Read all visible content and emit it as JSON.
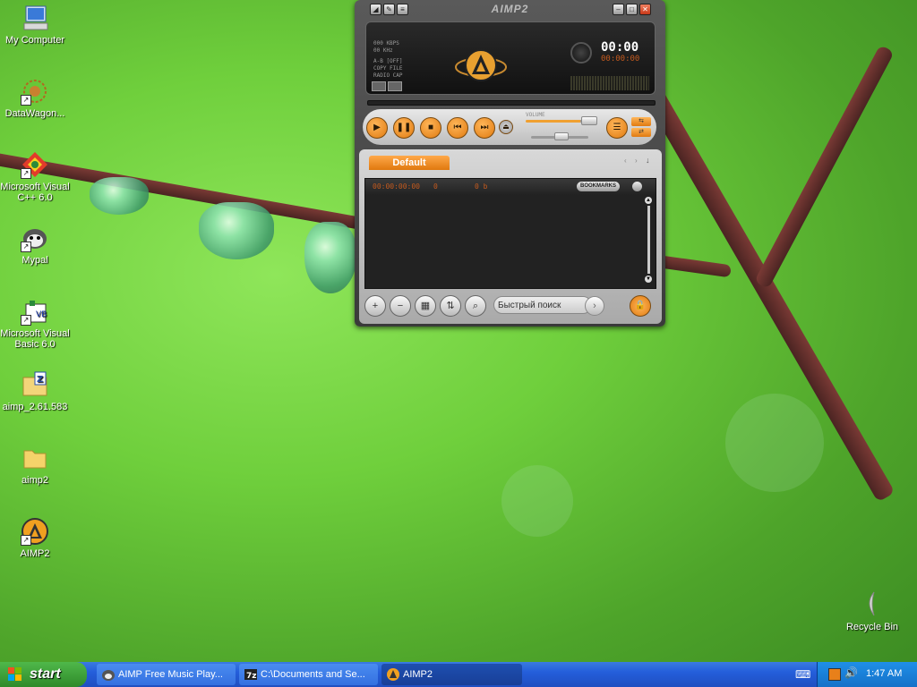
{
  "desktop_icons": [
    {
      "label": "My Computer",
      "icon": "my-computer-icon"
    },
    {
      "label": "DataWagon...",
      "icon": "datawagon-icon"
    },
    {
      "label": "Microsoft Visual C++ 6.0",
      "icon": "visual-cpp-icon"
    },
    {
      "label": "Mypal",
      "icon": "mypal-icon"
    },
    {
      "label": "Microsoft Visual Basic 6.0",
      "icon": "visual-basic-icon"
    },
    {
      "label": "aimp_2.61.583",
      "icon": "zip-archive-icon"
    },
    {
      "label": "aimp2",
      "icon": "folder-icon"
    },
    {
      "label": "AIMP2",
      "icon": "aimp-icon"
    }
  ],
  "recycle_bin": {
    "label": "Recycle Bin"
  },
  "aimp": {
    "title": "AIMP2",
    "info_lines": [
      "000 KBPS",
      "00 KHz",
      "A-B [OFF]",
      "COPY FILE",
      "RADIO CAP"
    ],
    "time": "00:00",
    "time_sub": "00:00:00",
    "volume_label": "VOLUME",
    "playlist_tab": "Default",
    "playlist_time": "00:00:00:00",
    "playlist_count": "0",
    "playlist_size": "0 b",
    "bookmarks_label": "BOOKMARKS",
    "search_placeholder": "Быстрый поиск"
  },
  "taskbar": {
    "start_label": "start",
    "tasks": [
      {
        "label": "AIMP Free Music Play...",
        "icon": "browser-icon"
      },
      {
        "label": "C:\\Documents and Se...",
        "icon": "7zip-icon"
      },
      {
        "label": "AIMP2",
        "icon": "aimp-icon"
      }
    ],
    "clock": "1:47 AM"
  }
}
